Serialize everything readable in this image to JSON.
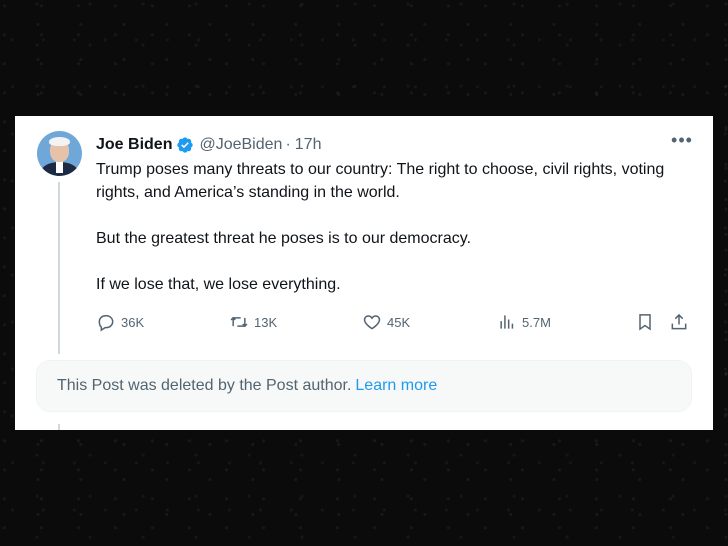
{
  "tweet": {
    "author_name": "Joe Biden",
    "handle": "@JoeBiden",
    "separator": "·",
    "time": "17h",
    "paragraphs": [
      "Trump poses many threats to our country: The right to choose, civil rights, voting rights, and America’s standing in the world.",
      "But the greatest threat he poses is to our democracy.",
      "If we lose that, we lose everything."
    ],
    "more_icon": "more-dots-icon",
    "verified_icon": "verified-badge-icon",
    "verified_color": "#1d9bf0"
  },
  "actions": {
    "replies": "36K",
    "reposts": "13K",
    "likes": "45K",
    "views": "5.7M",
    "icons": [
      "reply-icon",
      "repost-icon",
      "like-icon",
      "views-icon",
      "bookmark-icon",
      "share-icon"
    ]
  },
  "deleted_notice": {
    "text": "This Post was deleted by the Post author.",
    "link": "Learn more",
    "link_color": "#1d9bf0"
  }
}
